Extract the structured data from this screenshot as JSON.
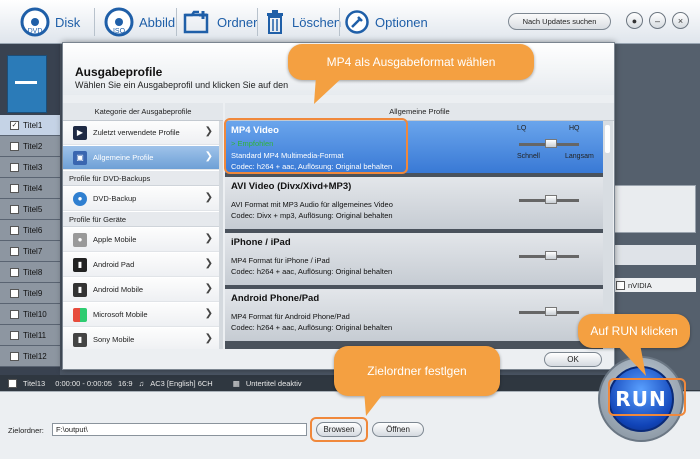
{
  "toolbar": {
    "disk_label": "Disk",
    "iso_label": "Abbild",
    "folder_label": "Ordner",
    "delete_label": "Löschen",
    "options_label": "Optionen",
    "update_label": "Nach Updates suchen",
    "dvd_badge": "DVD",
    "iso_badge": "ISO"
  },
  "titles": [
    "Titel1",
    "Titel2",
    "Titel3",
    "Titel4",
    "Titel5",
    "Titel6",
    "Titel7",
    "Titel8",
    "Titel9",
    "Titel10",
    "Titel11",
    "Titel12",
    "Titel13"
  ],
  "status_bar": {
    "time": "0:00:00 - 0:00:05",
    "aspect": "16:9",
    "audio": "AC3 [English] 6CH",
    "subtitle": "Untertitel deaktiv"
  },
  "nvidia_label": "nVIDIA",
  "dialog": {
    "title": "Ausgabeprofile",
    "subtitle": "Wählen Sie ein Ausgabeprofil und klicken Sie auf den",
    "left_header": "Kategorie der Ausgabeprofile",
    "right_header": "Allgemeine Profile",
    "ok_label": "OK",
    "categories": {
      "recent": "Zuletzt verwendete Profile",
      "general": "Allgemeine Profile",
      "section_dvd": "Profile für DVD-Backups",
      "dvd_backup": "DVD-Backup",
      "section_devices": "Profile für Geräte",
      "apple": "Apple Mobile",
      "android_pad": "Android Pad",
      "android_mobile": "Android Mobile",
      "microsoft": "Microsoft Mobile",
      "sony": "Sony Mobile"
    },
    "quality": {
      "lq": "LQ",
      "hq": "HQ",
      "fast": "Schnell",
      "slow": "Langsam"
    },
    "profiles": [
      {
        "name": "MP4 Video",
        "recommended": "> Empfohlen",
        "desc": "Standard MP4 Multimedia-Format",
        "codec": "Codec: h264 + aac, Auflösung: Original behalten"
      },
      {
        "name": "AVI Video (Divx/Xivd+MP3)",
        "desc": "AVI Format mit MP3 Audio für allgemeines Video",
        "codec": "Codec: Divx + mp3, Auflösung: Original behalten"
      },
      {
        "name": "iPhone / iPad",
        "desc": "MP4 Format für iPhone / iPad",
        "codec": "Codec: h264 + aac, Auflösung: Original behalten"
      },
      {
        "name": "Android Phone/Pad",
        "desc": "MP4 Format für Android Phone/Pad",
        "codec": "Codec: h264 + aac, Auflösung: Original behalten"
      }
    ]
  },
  "callouts": {
    "mp4": "MP4 als Ausgabeformat wählen",
    "run": "Auf RUN klicken",
    "folder": "Zielordner festlgen"
  },
  "output": {
    "label": "Zielordner:",
    "path": "F:\\output\\",
    "browse_label": "Browsen",
    "open_label": "Öffnen"
  },
  "run_label": "RUN",
  "colors": {
    "accent": "#3979d5",
    "callout": "#f4a041",
    "recommended": "#2fb43a"
  }
}
